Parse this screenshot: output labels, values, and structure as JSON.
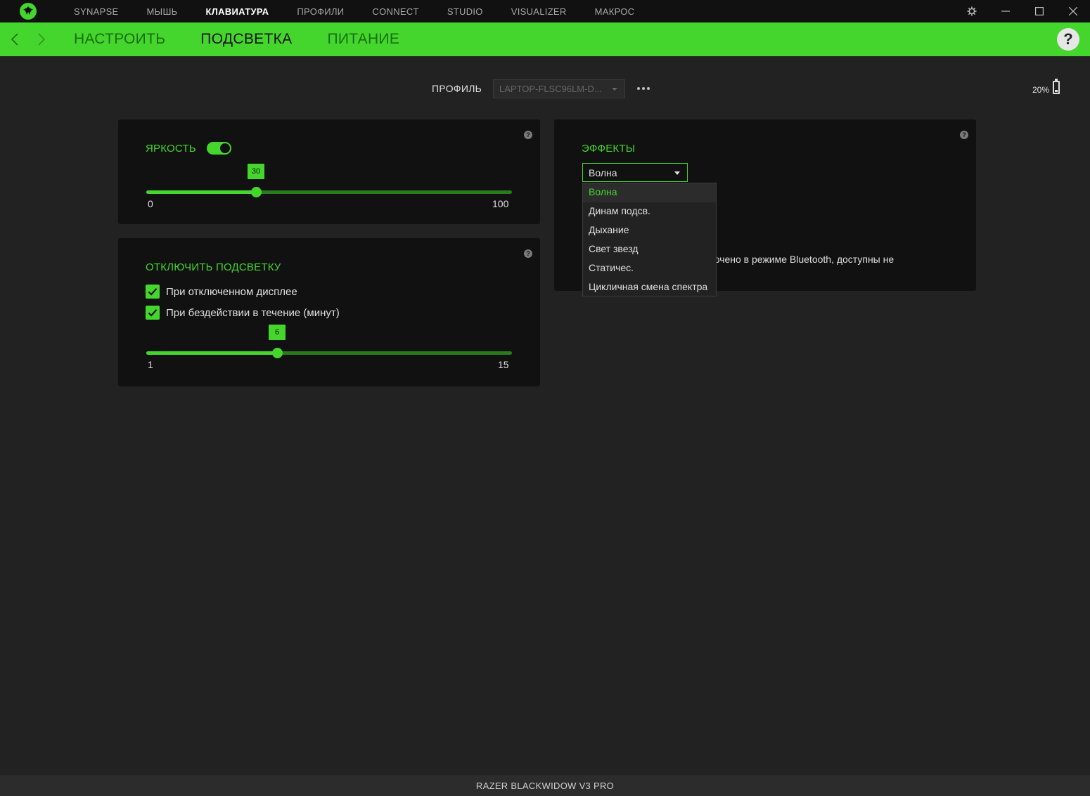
{
  "topnav": {
    "items": [
      "SYNAPSE",
      "МЫШЬ",
      "КЛАВИАТУРА",
      "ПРОФИЛИ",
      "CONNECT",
      "STUDIO",
      "VISUALIZER",
      "МАКРОС"
    ],
    "active_index": 2
  },
  "window": {
    "settings_icon": "gear-icon",
    "minimize_icon": "minimize-icon",
    "maximize_icon": "maximize-icon",
    "close_icon": "close-icon"
  },
  "subnav": {
    "tabs": [
      "НАСТРОИТЬ",
      "ПОДСВЕТКА",
      "ПИТАНИЕ"
    ],
    "active_index": 1,
    "help_label": "?"
  },
  "profile": {
    "label": "ПРОФИЛЬ",
    "value": "LAPTOP-FLSC96LM-D..."
  },
  "battery": {
    "text": "20%",
    "level": 0.2
  },
  "brightness": {
    "title": "ЯРКОСТЬ",
    "enabled": true,
    "value": 30,
    "value_label": "30",
    "min": 0,
    "max": 100,
    "min_label": "0",
    "max_label": "100"
  },
  "lighting_off": {
    "title": "ОТКЛЮЧИТЬ ПОДСВЕТКУ",
    "options": [
      {
        "label": "При отключенном дисплее",
        "checked": true
      },
      {
        "label": "При бездействии в течение (минут)",
        "checked": true
      }
    ],
    "value": 6,
    "value_label": "6",
    "min": 1,
    "max": 15,
    "min_label": "1",
    "max_label": "15"
  },
  "effects": {
    "title": "ЭФФЕКТЫ",
    "selected": "Волна",
    "options": [
      "Волна",
      "Динам подсв.",
      "Дыхание",
      "Свет звезд",
      "Статичес.",
      "Цикличная смена спектра"
    ],
    "note": "ючено в режиме Bluetooth, доступны не"
  },
  "help_icon_label": "?",
  "footer": {
    "device": "RAZER BLACKWIDOW V3 PRO"
  },
  "colors": {
    "accent": "#44d62c",
    "panel": "#111111",
    "background": "#222222"
  }
}
